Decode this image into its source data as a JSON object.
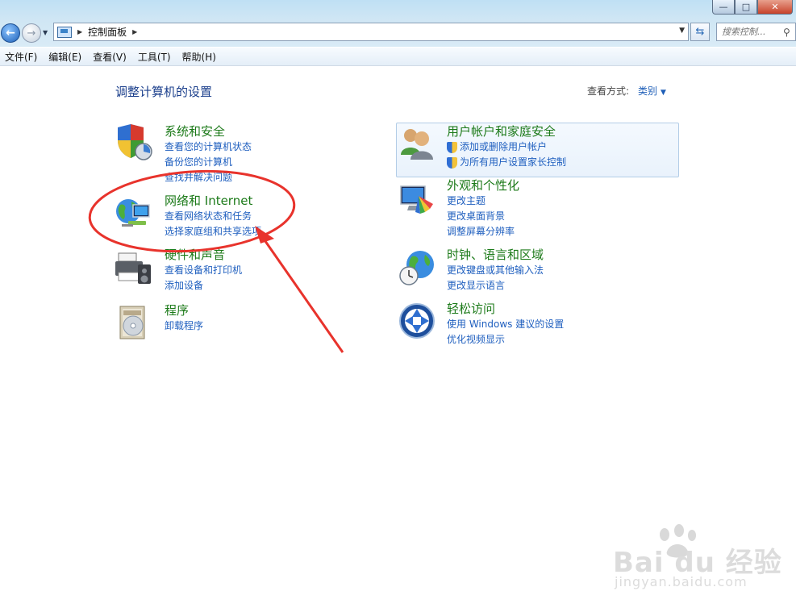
{
  "window": {
    "min_glyph": "—",
    "max_glyph": "□",
    "close_glyph": "✕"
  },
  "address": {
    "breadcrumb": "控制面板",
    "search_placeholder": "搜索控制..."
  },
  "menu": [
    "文件(F)",
    "编辑(E)",
    "查看(V)",
    "工具(T)",
    "帮助(H)"
  ],
  "content": {
    "heading": "调整计算机的设置",
    "view_by_label": "查看方式:",
    "view_by_value": "类别"
  },
  "categories_left": [
    {
      "icon": "security-shield-icon",
      "title": "系统和安全",
      "links": [
        "查看您的计算机状态",
        "备份您的计算机",
        "查找并解决问题"
      ]
    },
    {
      "icon": "network-globe-icon",
      "title": "网络和 Internet",
      "links": [
        "查看网络状态和任务",
        "选择家庭组和共享选项"
      ]
    },
    {
      "icon": "hardware-printer-icon",
      "title": "硬件和声音",
      "links": [
        "查看设备和打印机",
        "添加设备"
      ]
    },
    {
      "icon": "programs-disc-icon",
      "title": "程序",
      "links": [
        "卸载程序"
      ]
    }
  ],
  "categories_right": [
    {
      "icon": "user-accounts-icon",
      "title": "用户帐户和家庭安全",
      "links": [
        "添加或删除用户帐户",
        "为所有用户设置家长控制"
      ]
    },
    {
      "icon": "appearance-monitor-icon",
      "title": "外观和个性化",
      "links": [
        "更改主题",
        "更改桌面背景",
        "调整屏幕分辨率"
      ]
    },
    {
      "icon": "clock-globe-icon",
      "title": "时钟、语言和区域",
      "links": [
        "更改键盘或其他输入法",
        "更改显示语言"
      ]
    },
    {
      "icon": "ease-of-access-icon",
      "title": "轻松访问",
      "links": [
        "使用 Windows 建议的设置",
        "优化视频显示"
      ]
    }
  ],
  "watermark": {
    "brand": "Bai du 经验",
    "url": "jingyan.baidu.com"
  },
  "colors": {
    "accent_link": "#1f5fbf",
    "category_title": "#1c7a19",
    "heading": "#1b3f8c",
    "annotation_red": "#e8332c"
  }
}
